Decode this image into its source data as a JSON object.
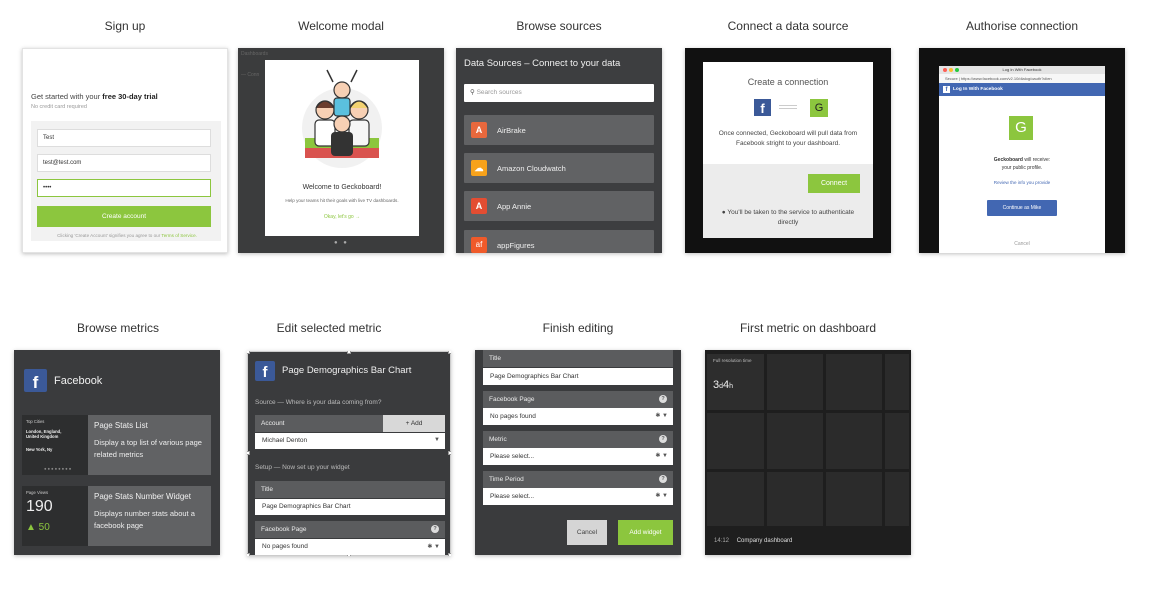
{
  "labels": {
    "signup": "Sign up",
    "welcome": "Welcome modal",
    "sources": "Browse sources",
    "connect": "Connect a data source",
    "authorise": "Authorise connection",
    "metrics": "Browse metrics",
    "edit": "Edit selected metric",
    "finish": "Finish editing",
    "dashboard": "First metric on dashboard"
  },
  "signup": {
    "headline_prefix": "Get started with your ",
    "headline_bold": "free 30-day trial",
    "subline": "No credit card required",
    "name_value": "Test",
    "email_value": "test@test.com",
    "password_value": "••••",
    "button": "Create account",
    "terms_prefix": "Clicking 'Create Account' signifies you agree to our ",
    "terms_link": "Terms of Service."
  },
  "welcome": {
    "title": "Welcome to Geckoboard!",
    "description": "Help your teams hit their goals with live TV dashboards.",
    "link": "Okay, let's go →",
    "bg_text_1": "— Conn",
    "bg_text_2": "Dashboards"
  },
  "sources": {
    "title": "Data Sources – Connect to your data",
    "search_placeholder": "Search sources",
    "items": [
      {
        "name": "AirBrake",
        "icon": "airbrake-icon",
        "color": "#e8683d",
        "glyph": "A"
      },
      {
        "name": "Amazon Cloudwatch",
        "icon": "cloudwatch-icon",
        "color": "#f7a21b",
        "glyph": "☁"
      },
      {
        "name": "App Annie",
        "icon": "appannie-icon",
        "color": "#e34d32",
        "glyph": "A"
      },
      {
        "name": "appFigures",
        "icon": "appfigures-icon",
        "color": "#ef5a2a",
        "glyph": "af"
      }
    ]
  },
  "connect": {
    "title": "Create a connection",
    "fb_glyph": "f",
    "gb_glyph": "G",
    "description": "Once connected, Geckoboard will pull data from Facebook stright to your dashboard.",
    "button": "Connect",
    "note": "You'll be taken to the service to authenticate directly"
  },
  "authorise": {
    "window_title": "Log In With Facebook",
    "url": "Secure | https://www.facebook.com/v2.10/dialog/oauth?clien",
    "bar_title": "Log In With Facebook",
    "app_glyph": "G",
    "text_bold": "Geckoboard",
    "text_rest": " will receive:",
    "text_line2": "your public profile.",
    "review": "Review the info you provide",
    "continue": "Continue as Mike",
    "cancel": "Cancel"
  },
  "metrics": {
    "title": "Facebook",
    "fb_glyph": "f",
    "items": [
      {
        "title": "Page Stats List",
        "description": "Display a top list of various page related metrics",
        "preview_title": "Top Cities",
        "preview_lines": [
          "London, England,",
          "United Kingdom",
          "New York, Ny"
        ]
      },
      {
        "title": "Page Stats Number Widget",
        "description": "Displays number stats about a facebook page",
        "preview_title": "Page Views",
        "value": "190",
        "delta": "▲ 50"
      }
    ]
  },
  "edit": {
    "title": "Page Demographics Bar Chart",
    "fb_glyph": "f",
    "source_section": "Source — Where is your data coming from?",
    "account_label": "Account",
    "add_label": "+ Add",
    "account_value": "Michael Denton",
    "setup_section": "Setup — Now set up your widget",
    "title_label": "Title",
    "title_value": "Page Demographics Bar Chart",
    "page_label": "Facebook Page",
    "page_value": "No pages found"
  },
  "finish": {
    "title_label": "Title",
    "title_value": "Page Demographics Bar Chart",
    "page_label": "Facebook Page",
    "page_value": "No pages found",
    "metric_label": "Metric",
    "metric_value": "Please select...",
    "period_label": "Time Period",
    "period_value": "Please select...",
    "cancel": "Cancel",
    "add": "Add widget"
  },
  "dashboard": {
    "tile_title": "Full resolution time",
    "tile_value_major": "3",
    "tile_value_unit1": "d",
    "tile_value_minor": "4",
    "tile_value_unit2": "h",
    "time": "14:12",
    "name": "Company dashboard"
  },
  "colors": {
    "accent_green": "#8cc63e",
    "facebook_blue": "#3b5998",
    "panel_dark": "#3a3b3d"
  }
}
